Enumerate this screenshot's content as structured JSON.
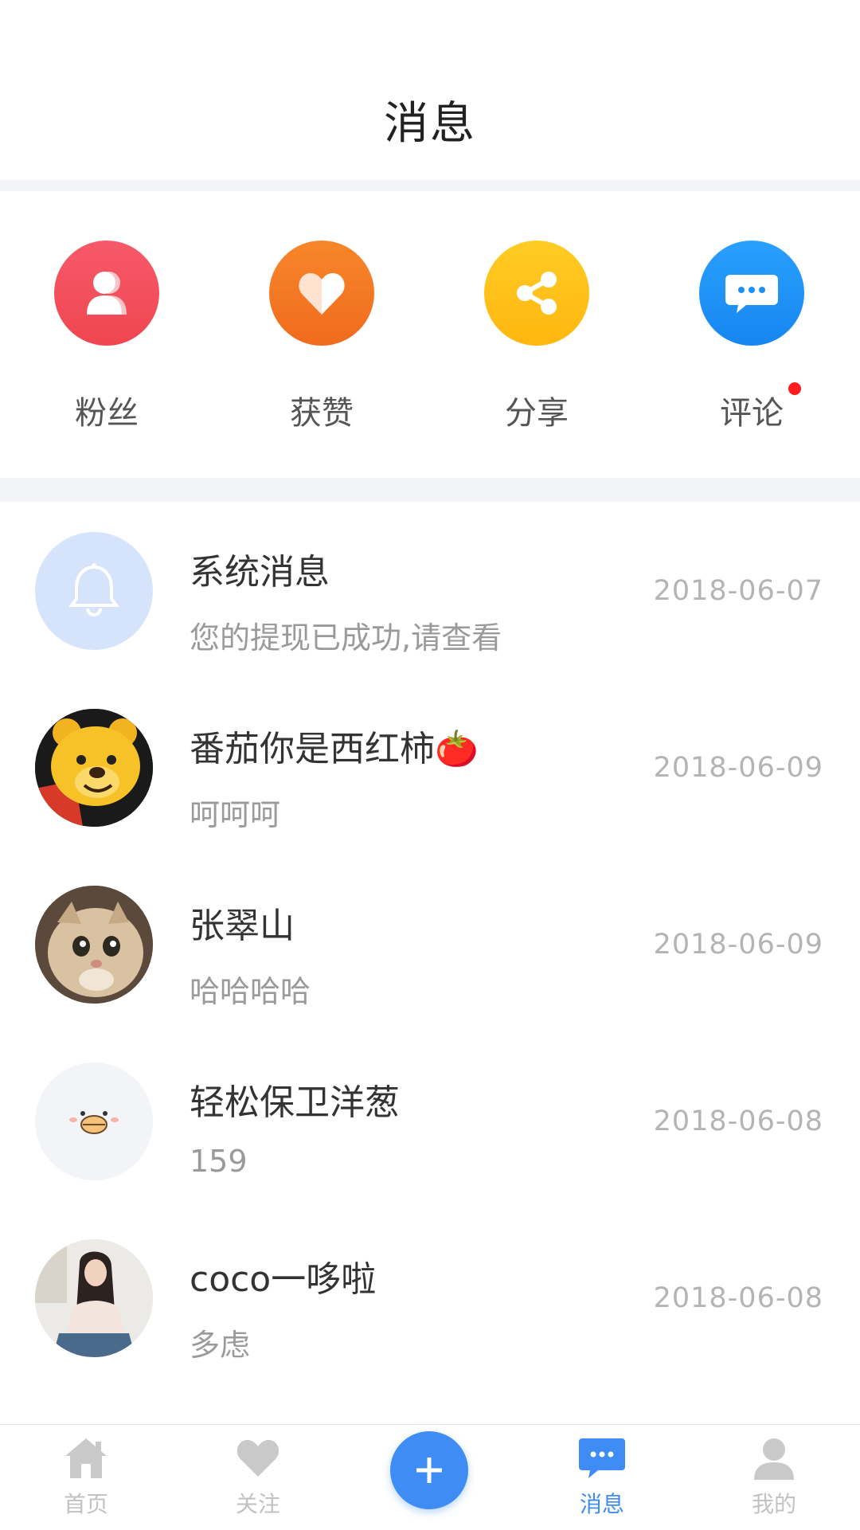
{
  "header": {
    "title": "消息"
  },
  "quick_actions": [
    {
      "label": "粉丝",
      "icon": "fans-icon",
      "color": "#f04b55"
    },
    {
      "label": "获赞",
      "icon": "heart-icon",
      "color": "#f7721f"
    },
    {
      "label": "分享",
      "icon": "share-icon",
      "color": "#ffc21a"
    },
    {
      "label": "评论",
      "icon": "comment-icon",
      "color": "#1a92f5",
      "has_unread_dot": true
    }
  ],
  "messages": [
    {
      "name": "系统消息",
      "preview": "您的提现已成功,请查看",
      "date": "2018-06-07",
      "avatar": "bell-icon"
    },
    {
      "name": "番茄你是西红柿🍅",
      "preview": "呵呵呵",
      "date": "2018-06-09",
      "avatar": "bear-avatar"
    },
    {
      "name": "张翠山",
      "preview": "哈哈哈哈",
      "date": "2018-06-09",
      "avatar": "cat-avatar"
    },
    {
      "name": "轻松保卫洋葱",
      "preview": "159",
      "date": "2018-06-08",
      "avatar": "chick-avatar"
    },
    {
      "name": "coco一哆啦",
      "preview": "多虑",
      "date": "2018-06-08",
      "avatar": "girl-avatar"
    }
  ],
  "tabbar": {
    "tabs": [
      {
        "label": "首页",
        "icon": "home-icon",
        "active": false
      },
      {
        "label": "关注",
        "icon": "heart-icon",
        "active": false
      },
      {
        "label": "消息",
        "icon": "message-icon",
        "active": true
      },
      {
        "label": "我的",
        "icon": "user-icon",
        "active": false
      }
    ],
    "center_button": {
      "icon": "plus-icon"
    },
    "active_color": "#3f8cf4",
    "inactive_color": "#c2c2c2"
  }
}
